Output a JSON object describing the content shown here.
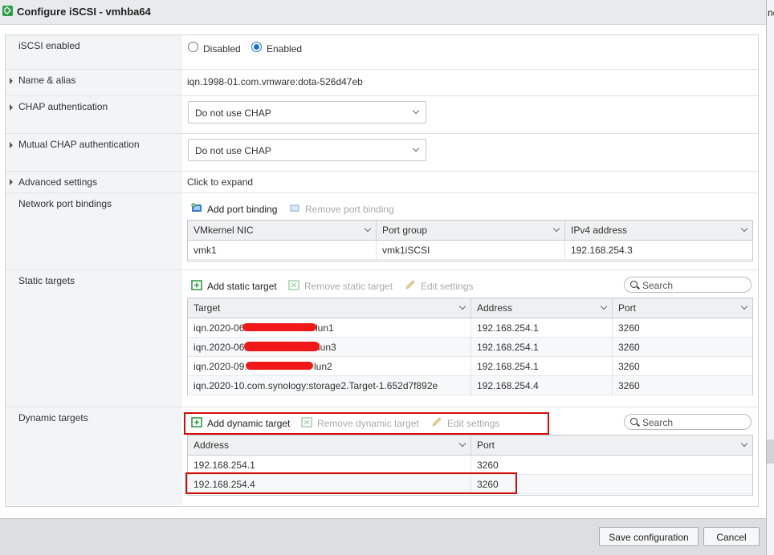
{
  "window": {
    "title": "Configure iSCSI - vmhba64",
    "right_peek_text": "ne"
  },
  "iscsi_enabled": {
    "label": "iSCSI enabled",
    "options": [
      "Disabled",
      "Enabled"
    ],
    "selected": "Enabled"
  },
  "name_alias": {
    "label": "Name & alias",
    "value": "iqn.1998-01.com.vmware:dota-526d47eb"
  },
  "chap": {
    "label": "CHAP authentication",
    "value": "Do not use CHAP"
  },
  "mutual_chap": {
    "label": "Mutual CHAP authentication",
    "value": "Do not use CHAP"
  },
  "advanced": {
    "label": "Advanced settings",
    "value": "Click to expand"
  },
  "port_bindings": {
    "label": "Network port bindings",
    "add_label": "Add port binding",
    "remove_label": "Remove port binding",
    "columns": [
      "VMkernel NIC",
      "Port group",
      "IPv4 address"
    ],
    "rows": [
      [
        "vmk1",
        "vmk1iSCSI",
        "192.168.254.3"
      ]
    ]
  },
  "static_targets": {
    "label": "Static targets",
    "add_label": "Add static target",
    "remove_label": "Remove static target",
    "edit_label": "Edit settings",
    "search_placeholder": "Search",
    "columns": [
      "Target",
      "Address",
      "Port"
    ],
    "rows": [
      {
        "target_prefix": "iqn.2020-06.",
        "target_suffix": "lun1",
        "address": "192.168.254.1",
        "port": "3260"
      },
      {
        "target_prefix": "iqn.2020-06.",
        "target_suffix": "lun3",
        "address": "192.168.254.1",
        "port": "3260"
      },
      {
        "target_prefix": "iqn.2020-09.",
        "target_suffix": "lun2",
        "address": "192.168.254.1",
        "port": "3260"
      },
      {
        "target_prefix": "iqn.2020-10.com.synology:storage2.Target-1.652d7f892e",
        "target_suffix": "",
        "address": "192.168.254.4",
        "port": "3260"
      }
    ]
  },
  "dynamic_targets": {
    "label": "Dynamic targets",
    "add_label": "Add dynamic target",
    "remove_label": "Remove dynamic target",
    "edit_label": "Edit settings",
    "search_placeholder": "Search",
    "columns": [
      "Address",
      "Port"
    ],
    "rows": [
      {
        "address": "192.168.254.1",
        "port": "3260"
      },
      {
        "address": "192.168.254.4",
        "port": "3260"
      }
    ]
  },
  "footer": {
    "save_label": "Save configuration",
    "cancel_label": "Cancel"
  },
  "colors": {
    "accent": "#1b73d1",
    "highlight_red": "#d40c0c",
    "label_bg": "#f2f4f6",
    "icon_green": "#2f9c47"
  }
}
